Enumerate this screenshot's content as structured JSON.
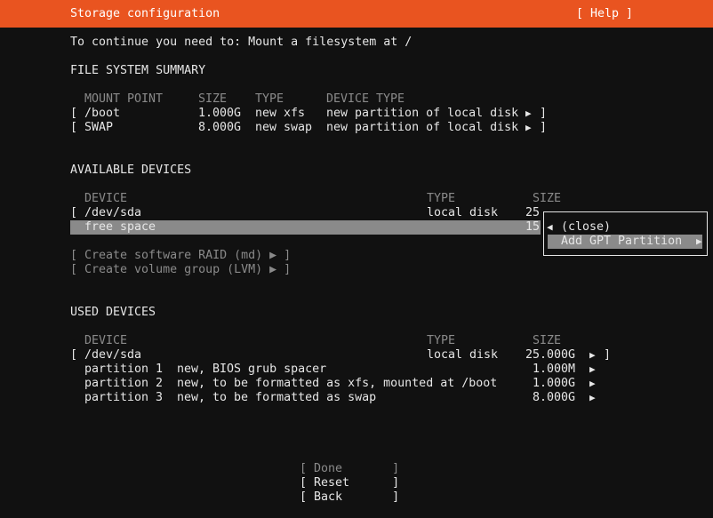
{
  "header": {
    "title": "Storage configuration",
    "help": "[ Help ]"
  },
  "instruction": "To continue you need to: Mount a filesystem at /",
  "fs_summary": {
    "title": "FILE SYSTEM SUMMARY",
    "columns": [
      "MOUNT POINT",
      "SIZE",
      "TYPE",
      "DEVICE TYPE"
    ],
    "rows": [
      {
        "bracket": "[",
        "mount": "/boot",
        "size": "1.000G",
        "type": "new xfs",
        "device_type": "new partition of local disk",
        "arrow": "▶",
        "close": "]"
      },
      {
        "bracket": "[",
        "mount": "SWAP",
        "size": "8.000G",
        "type": "new swap",
        "device_type": "new partition of local disk",
        "arrow": "▶",
        "close": "]"
      }
    ]
  },
  "available": {
    "title": "AVAILABLE DEVICES",
    "columns": [
      "DEVICE",
      "TYPE",
      "SIZE"
    ],
    "device": {
      "bracket": "[",
      "name": "/dev/sda",
      "type": "local disk",
      "size": "25"
    },
    "free": {
      "name": "free space",
      "size": "15"
    },
    "raid": "[ Create software RAID (md) ▶ ]",
    "lvm": "[ Create volume group (LVM) ▶ ]"
  },
  "context_menu": {
    "close_arrow": "◀",
    "close": "(close)",
    "add": "Add GPT Partition",
    "add_arrow": "▶"
  },
  "used": {
    "title": "USED DEVICES",
    "columns": [
      "DEVICE",
      "TYPE",
      "SIZE"
    ],
    "device": {
      "bracket": "[",
      "name": "/dev/sda",
      "type": "local disk",
      "size": "25.000G",
      "arrow": "▶",
      "close": "]"
    },
    "partitions": [
      {
        "label": "partition 1",
        "desc": "new, BIOS grub spacer",
        "size": "1.000M",
        "arrow": "▶"
      },
      {
        "label": "partition 2",
        "desc": "new, to be formatted as xfs, mounted at /boot",
        "size": "1.000G",
        "arrow": "▶"
      },
      {
        "label": "partition 3",
        "desc": "new, to be formatted as swap",
        "size": "8.000G",
        "arrow": "▶"
      }
    ]
  },
  "buttons": {
    "done": "[ Done       ]",
    "reset": "[ Reset      ]",
    "back": "[ Back       ]"
  },
  "colors": {
    "header_bg": "#e95420",
    "background": "#111111",
    "highlight": "#8a8a8a",
    "text": "#e6e6e6",
    "disabled": "#8a8a8a"
  }
}
